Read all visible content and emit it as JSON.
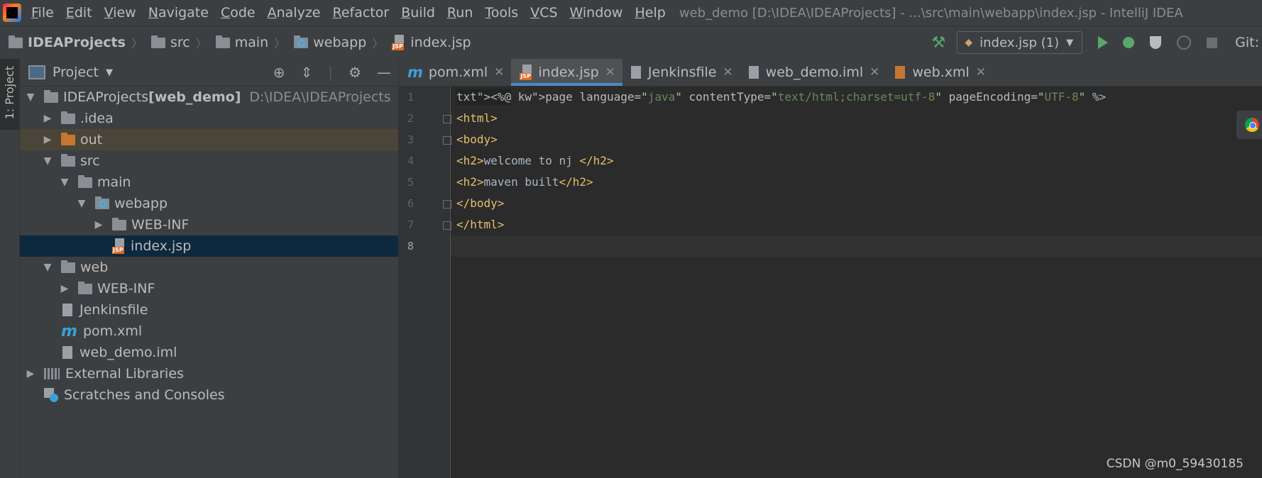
{
  "menu": {
    "items": [
      "File",
      "Edit",
      "View",
      "Navigate",
      "Code",
      "Analyze",
      "Refactor",
      "Build",
      "Run",
      "Tools",
      "VCS",
      "Window",
      "Help"
    ],
    "window_title": "web_demo [D:\\IDEA\\IDEAProjects] - ...\\src\\main\\webapp\\index.jsp - IntelliJ IDEA"
  },
  "breadcrumb": {
    "items": [
      "IDEAProjects",
      "src",
      "main",
      "webapp",
      "index.jsp"
    ]
  },
  "toolbar": {
    "run_config": "index.jsp (1)",
    "git_label": "Git:"
  },
  "sidebar_strip": {
    "label": "1: Project"
  },
  "project_panel": {
    "title": "Project",
    "tree": [
      {
        "label": "IDEAProjects",
        "suffix": "[web_demo]",
        "path": "D:\\IDEA\\IDEAProjects",
        "depth": 0,
        "arrow": "down",
        "icon": "module-folder"
      },
      {
        "label": ".idea",
        "depth": 1,
        "arrow": "right",
        "icon": "folder"
      },
      {
        "label": "out",
        "depth": 1,
        "arrow": "right",
        "icon": "folder-orange",
        "highlight": true
      },
      {
        "label": "src",
        "depth": 1,
        "arrow": "down",
        "icon": "folder"
      },
      {
        "label": "main",
        "depth": 2,
        "arrow": "down",
        "icon": "folder"
      },
      {
        "label": "webapp",
        "depth": 3,
        "arrow": "down",
        "icon": "web-folder"
      },
      {
        "label": "WEB-INF",
        "depth": 4,
        "arrow": "right",
        "icon": "folder"
      },
      {
        "label": "index.jsp",
        "depth": 4,
        "arrow": "none",
        "icon": "jsp",
        "selected": true
      },
      {
        "label": "web",
        "depth": 1,
        "arrow": "down",
        "icon": "folder"
      },
      {
        "label": "WEB-INF",
        "depth": 2,
        "arrow": "right",
        "icon": "folder"
      },
      {
        "label": "Jenkinsfile",
        "depth": 1,
        "arrow": "none",
        "icon": "file"
      },
      {
        "label": "pom.xml",
        "depth": 1,
        "arrow": "none",
        "icon": "maven"
      },
      {
        "label": "web_demo.iml",
        "depth": 1,
        "arrow": "none",
        "icon": "file"
      },
      {
        "label": "External Libraries",
        "depth": 0,
        "arrow": "right",
        "icon": "libraries"
      },
      {
        "label": "Scratches and Consoles",
        "depth": 0,
        "arrow": "none",
        "icon": "scratches"
      }
    ]
  },
  "editor": {
    "tabs": [
      {
        "label": "pom.xml",
        "icon": "maven",
        "active": false
      },
      {
        "label": "index.jsp",
        "icon": "jsp",
        "active": true
      },
      {
        "label": "Jenkinsfile",
        "icon": "file",
        "active": false
      },
      {
        "label": "web_demo.iml",
        "icon": "file",
        "active": false
      },
      {
        "label": "web.xml",
        "icon": "xml",
        "active": false
      }
    ],
    "line_numbers": [
      "1",
      "2",
      "3",
      "4",
      "5",
      "6",
      "7",
      "8"
    ],
    "lines": [
      "<%@ page language=\"java\" contentType=\"text/html;charset=utf-8\" pageEncoding=\"UTF-8\" %>",
      "<html>",
      "<body>",
      "<h2>welcome to nj </h2>",
      "<h2>maven built</h2>",
      "</body>",
      "</html>",
      ""
    ]
  },
  "watermark": "CSDN @m0_59430185"
}
